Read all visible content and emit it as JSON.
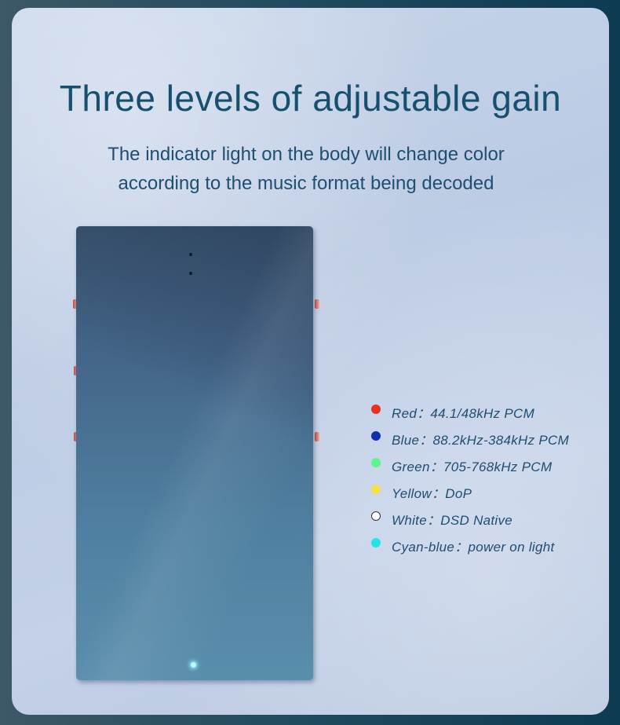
{
  "heading": {
    "title": "Three levels of adjustable gain",
    "subtitle_line1": "The indicator light on the body will change color",
    "subtitle_line2": "according to the music format being decoded"
  },
  "product_image": {
    "icon": "headphone-amp-dac-device-icon",
    "indicator_led_color": "#bff6fa"
  },
  "legend": [
    {
      "text": "Red：44.1/48kHz PCM",
      "color": "#e8301e"
    },
    {
      "text": "Blue：88.2kHz-384kHz PCM",
      "color": "#0f2fb0"
    },
    {
      "text": "Green：705-768kHz PCM",
      "color": "#5ef58a"
    },
    {
      "text": "Yellow：DoP",
      "color": "#f5e04a"
    },
    {
      "text": "White：DSD Native",
      "color": "#ffffff"
    },
    {
      "text": "Cyan-blue：power on light",
      "color": "#22e4e4"
    }
  ],
  "colors": {
    "title": "#17506e",
    "body_text": "#1e4e72",
    "card_background": "#c3d1e8"
  }
}
